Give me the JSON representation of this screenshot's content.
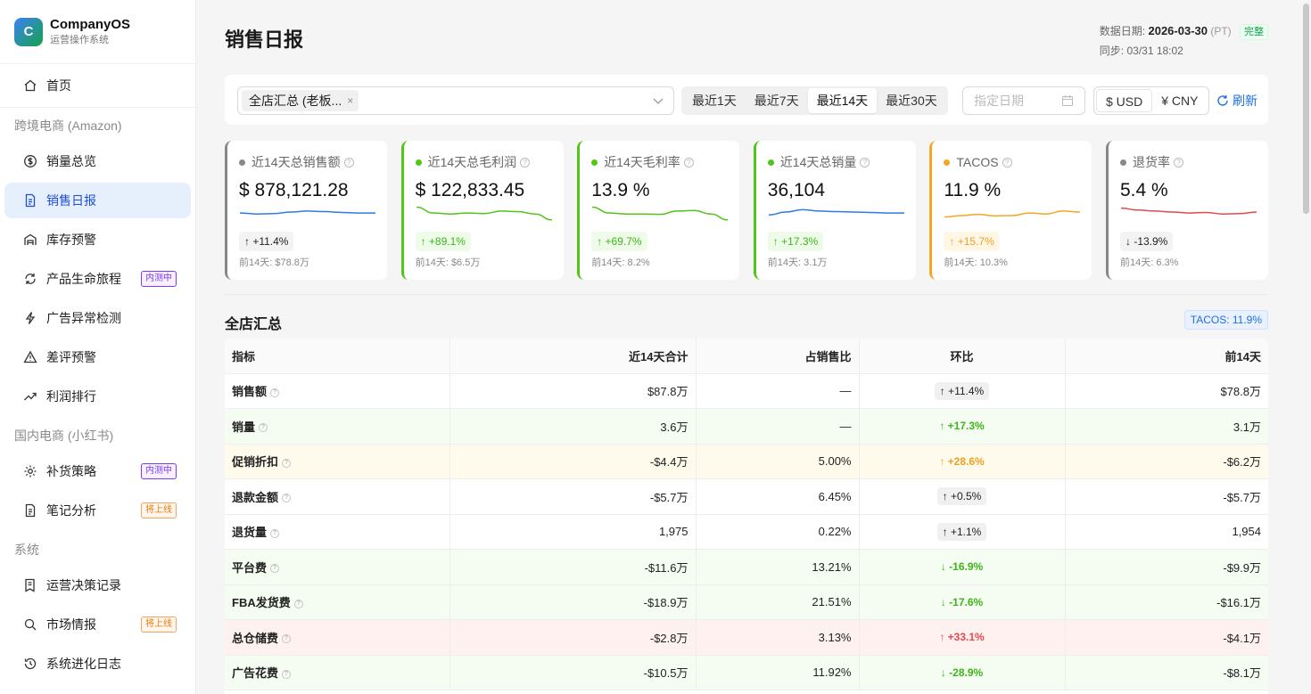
{
  "brand": {
    "logo": "C",
    "name": "CompanyOS",
    "subtitle": "运营操作系统"
  },
  "sidebar": {
    "home": {
      "label": "首页",
      "icon": "home-icon"
    },
    "groups": [
      {
        "label": "跨境电商 (Amazon)"
      },
      {
        "label": "国内电商 (小红书)"
      },
      {
        "label": "系统"
      }
    ],
    "items": [
      {
        "label": "销量总览",
        "icon": "dollar-circle-icon"
      },
      {
        "label": "销售日报",
        "icon": "document-icon",
        "active": true
      },
      {
        "label": "库存预警",
        "icon": "warehouse-icon"
      },
      {
        "label": "产品生命旅程",
        "icon": "refresh-cycle-icon",
        "badge": "内测中"
      },
      {
        "label": "广告异常检测",
        "icon": "lightning-icon"
      },
      {
        "label": "差评预警",
        "icon": "warning-triangle-icon"
      },
      {
        "label": "利润排行",
        "icon": "trend-up-icon"
      },
      {
        "label": "补货策略",
        "icon": "gear-icon",
        "badge": "内测中"
      },
      {
        "label": "笔记分析",
        "icon": "document-icon",
        "badge": "将上线"
      },
      {
        "label": "运营决策记录",
        "icon": "record-list-icon"
      },
      {
        "label": "市场情报",
        "icon": "search-icon",
        "badge": "将上线"
      },
      {
        "label": "系统进化日志",
        "icon": "clock-history-icon"
      }
    ]
  },
  "header": {
    "title": "销售日报",
    "data_date_label": "数据日期:",
    "data_date": "2026-03-30",
    "tz": "(PT)",
    "status": "完整",
    "sync": "同步: 03/31 18:02"
  },
  "toolbar": {
    "store_tag": "全店汇总 (老板...",
    "store_tag_close": "×",
    "ranges": [
      "最近1天",
      "最近7天",
      "最近14天",
      "最近30天"
    ],
    "active_range": "最近14天",
    "date_placeholder": "指定日期",
    "currencies": [
      "$ USD",
      "¥ CNY"
    ],
    "active_currency": "$ USD",
    "refresh_label": "刷新"
  },
  "kpis": [
    {
      "title": "近14天总销售额",
      "value": "$ 878,121.28",
      "delta": "+11.4%",
      "delta_dir": "up",
      "tone": "neutral",
      "prev": "前14天: $78.8万",
      "accent": "#888888",
      "line_color": "#2f7ae5",
      "spark": [
        0.55,
        0.6,
        0.58,
        0.5,
        0.45,
        0.48,
        0.52,
        0.55,
        0.55
      ]
    },
    {
      "title": "近14天总毛利润",
      "value": "$ 122,833.45",
      "delta": "+89.1%",
      "delta_dir": "up",
      "tone": "green",
      "prev": "前14天: $6.5万",
      "accent": "#52c41a",
      "line_color": "#52c41a",
      "spark": [
        0.25,
        0.55,
        0.6,
        0.55,
        0.58,
        0.45,
        0.48,
        0.6,
        0.9
      ]
    },
    {
      "title": "近14天毛利率",
      "value": "13.9 %",
      "delta": "+69.7%",
      "delta_dir": "up",
      "tone": "green",
      "prev": "前14天: 8.2%",
      "accent": "#52c41a",
      "line_color": "#52c41a",
      "spark": [
        0.25,
        0.55,
        0.6,
        0.6,
        0.62,
        0.45,
        0.42,
        0.6,
        0.9
      ]
    },
    {
      "title": "近14天总销量",
      "value": "36,104",
      "delta": "+17.3%",
      "delta_dir": "up",
      "tone": "green",
      "prev": "前14天: 3.1万",
      "accent": "#52c41a",
      "line_color": "#2f7ae5",
      "spark": [
        0.65,
        0.5,
        0.38,
        0.45,
        0.48,
        0.5,
        0.52,
        0.55,
        0.55
      ]
    },
    {
      "title": "TACOS",
      "value": "11.9 %",
      "delta": "+15.7%",
      "delta_dir": "up",
      "tone": "orange",
      "prev": "前14天: 10.3%",
      "accent": "#f5a623",
      "line_color": "#f5a623",
      "spark": [
        0.75,
        0.68,
        0.62,
        0.7,
        0.68,
        0.55,
        0.6,
        0.45,
        0.5
      ]
    },
    {
      "title": "退货率",
      "value": "5.4 %",
      "delta": "-13.9%",
      "delta_dir": "down",
      "tone": "neutral",
      "prev": "前14天: 6.3%",
      "accent": "#888888",
      "line_color": "#e5484d",
      "spark": [
        0.3,
        0.4,
        0.45,
        0.5,
        0.55,
        0.52,
        0.6,
        0.58,
        0.5
      ]
    }
  ],
  "section": {
    "title": "全店汇总",
    "tacos_pill": "TACOS: 11.9%"
  },
  "table": {
    "headers": [
      "指标",
      "近14天合计",
      "占销售比",
      "环比",
      "前14天"
    ],
    "rows": [
      {
        "name": "销售额",
        "total": "$87.8万",
        "ratio": "—",
        "mom": "+11.4%",
        "dir": "up",
        "tone": "neutral",
        "prev": "$78.8万",
        "bg": "none"
      },
      {
        "name": "销量",
        "total": "3.6万",
        "ratio": "—",
        "mom": "+17.3%",
        "dir": "up",
        "tone": "green",
        "prev": "3.1万",
        "bg": "green"
      },
      {
        "name": "促销折扣",
        "total": "-$4.4万",
        "ratio": "5.00%",
        "mom": "+28.6%",
        "dir": "up",
        "tone": "orange",
        "prev": "-$6.2万",
        "bg": "yellow"
      },
      {
        "name": "退款金额",
        "total": "-$5.7万",
        "ratio": "6.45%",
        "mom": "+0.5%",
        "dir": "up",
        "tone": "neutral",
        "prev": "-$5.7万",
        "bg": "none"
      },
      {
        "name": "退货量",
        "total": "1,975",
        "ratio": "0.22%",
        "mom": "+1.1%",
        "dir": "up",
        "tone": "neutral",
        "prev": "1,954",
        "bg": "none"
      },
      {
        "name": "平台费",
        "total": "-$11.6万",
        "ratio": "13.21%",
        "mom": "-16.9%",
        "dir": "down",
        "tone": "green",
        "prev": "-$9.9万",
        "bg": "green"
      },
      {
        "name": "FBA发货费",
        "total": "-$18.9万",
        "ratio": "21.51%",
        "mom": "-17.6%",
        "dir": "down",
        "tone": "green",
        "prev": "-$16.1万",
        "bg": "green"
      },
      {
        "name": "总仓储费",
        "total": "-$2.8万",
        "ratio": "3.13%",
        "mom": "+33.1%",
        "dir": "up",
        "tone": "red",
        "prev": "-$4.1万",
        "bg": "red"
      },
      {
        "name": "广告花费",
        "total": "-$10.5万",
        "ratio": "11.92%",
        "mom": "-28.9%",
        "dir": "down",
        "tone": "green",
        "prev": "-$8.1万",
        "bg": "green"
      }
    ]
  }
}
